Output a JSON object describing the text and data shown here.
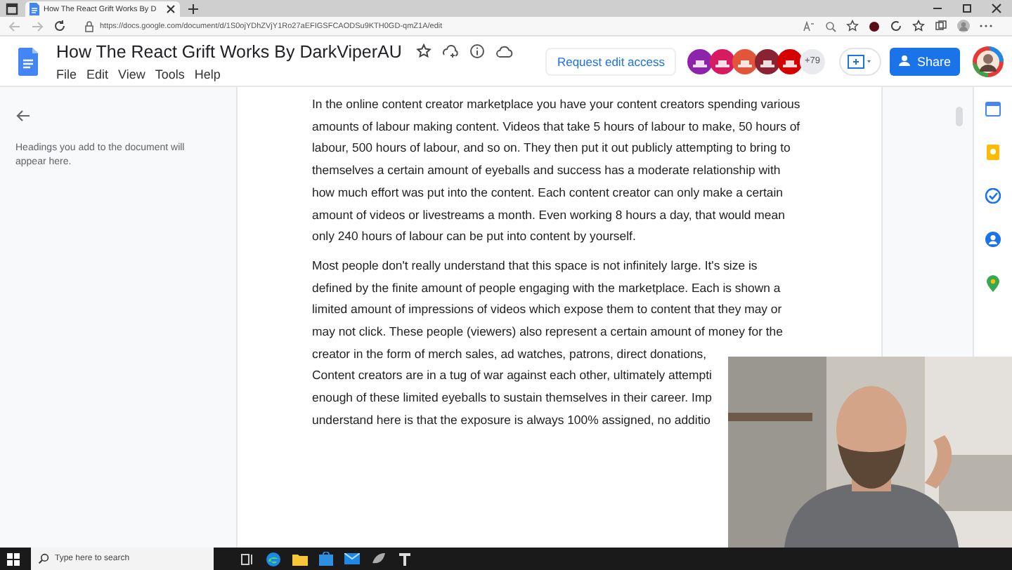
{
  "browser": {
    "tab_title": "How The React Grift Works By D",
    "url": "https://docs.google.com/document/d/1S0ojYDhZVjY1Ro27aEFIGSFCAODSu9KTH0GD-qmZ1A/edit"
  },
  "document": {
    "title": "How The React Grift Works By DarkViperAU",
    "menu": [
      "File",
      "Edit",
      "View",
      "Tools",
      "Help"
    ],
    "request_button": "Request edit access",
    "collaborators": [
      {
        "color": "#8e24aa"
      },
      {
        "color": "#d81b60"
      },
      {
        "color": "#e2553a"
      },
      {
        "color": "#8b2232"
      },
      {
        "color": "#d50000"
      }
    ],
    "more_count": "+79",
    "share_button": "Share"
  },
  "outline": {
    "hint": "Headings you add to the document will appear here."
  },
  "paragraphs": [
    {
      "kind": "text",
      "text": "In the online content creator marketplace you have your content creators spending various amounts of labour making content. Videos that take 5 hours of labour to make, 50 hours of labour, 500 hours of labour, and so on. They then put it out publicly attempting to bring to themselves a certain amount of eyeballs and success has a moderate relationship with how much effort was put into the content. Each content creator can only make a certain amount of videos or livestreams a month. Even working 8 hours a day, that would mean only 240 hours of labour can be put into content by yourself."
    },
    {
      "kind": "lines",
      "lines": [
        "Most people don't really understand that this space is not infinitely large. It's size is",
        "defined by the finite amount of people engaging with the marketplace. Each is shown a",
        "limited amount of impressions of videos which expose them to content that they may or",
        "may not click. These people (viewers) also represent a certain amount of money for the",
        "creator in the form of merch sales, ad watches, patrons, direct donations,",
        "Content creators are in a tug of war against each other, ultimately attempti",
        "enough of these limited eyeballs to sustain themselves in their career. Imp",
        "understand here is that the exposure is always 100% assigned, no additio"
      ]
    }
  ],
  "taskbar": {
    "search_placeholder": "Type here to search"
  }
}
